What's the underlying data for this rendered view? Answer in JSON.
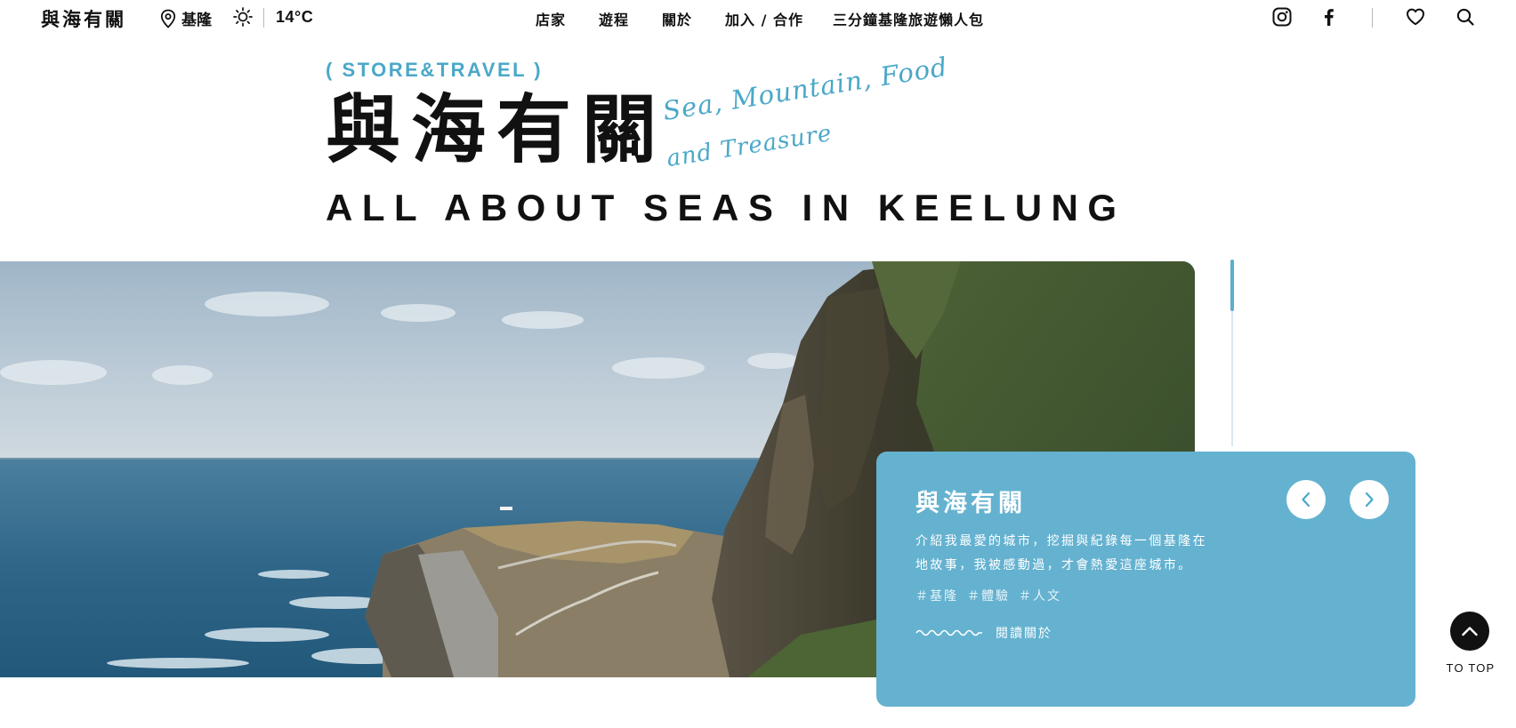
{
  "header": {
    "logo": "與海有關",
    "location": "基隆",
    "temperature": "14°C",
    "nav": [
      "店家",
      "遊程",
      "關於",
      "加入 / 合作",
      "三分鐘基隆旅遊懶人包"
    ]
  },
  "hero": {
    "tag": "( STORE&TRAVEL )",
    "title": "與海有關",
    "script_line1": "Sea, Mountain, Food",
    "script_line2": "and Treasure",
    "english_title": "ALL ABOUT SEAS IN KEELUNG"
  },
  "card": {
    "title": "與海有關",
    "description": "介紹我最愛的城市，挖掘與紀錄每一個基隆在地故事，我被感動過，才會熱愛這座城市。",
    "tags": [
      "＃基隆",
      "＃體驗",
      "＃人文"
    ],
    "read_more": "閱讀關於"
  },
  "to_top": "TO TOP",
  "colors": {
    "accent": "#4aa8c8",
    "card_bg": "#64b2d0",
    "text": "#111111"
  },
  "icons": [
    "location-pin-icon",
    "sun-icon",
    "instagram-icon",
    "facebook-icon",
    "heart-icon",
    "search-icon",
    "chevron-left-icon",
    "chevron-right-icon",
    "chevron-up-icon",
    "wave-line-icon"
  ]
}
